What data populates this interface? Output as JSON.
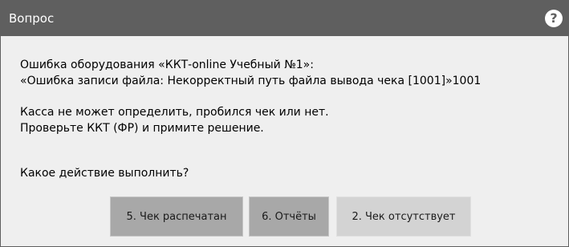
{
  "window": {
    "title": "Вопрос",
    "help_icon": "question-circle-icon",
    "colors": {
      "titlebar": "#5f5f5f",
      "body": "#efefef",
      "button_primary": "#a8a8a8",
      "button_secondary": "#d3d3d3"
    }
  },
  "message": {
    "line1": "Ошибка оборудования «ККТ-online Учебный №1»:",
    "line2": "«Ошибка записи файла: Некорректный путь файла вывода чека [1001]»1001",
    "line3": "Касса не может определить, пробился чек или нет.",
    "line4": "Проверьте ККТ (ФР) и примите решение.",
    "question": "Какое действие выполнить?"
  },
  "buttons": {
    "printed": "5. Чек распечатан",
    "reports": "6. Отчёты",
    "absent": "2. Чек отсутствует"
  }
}
